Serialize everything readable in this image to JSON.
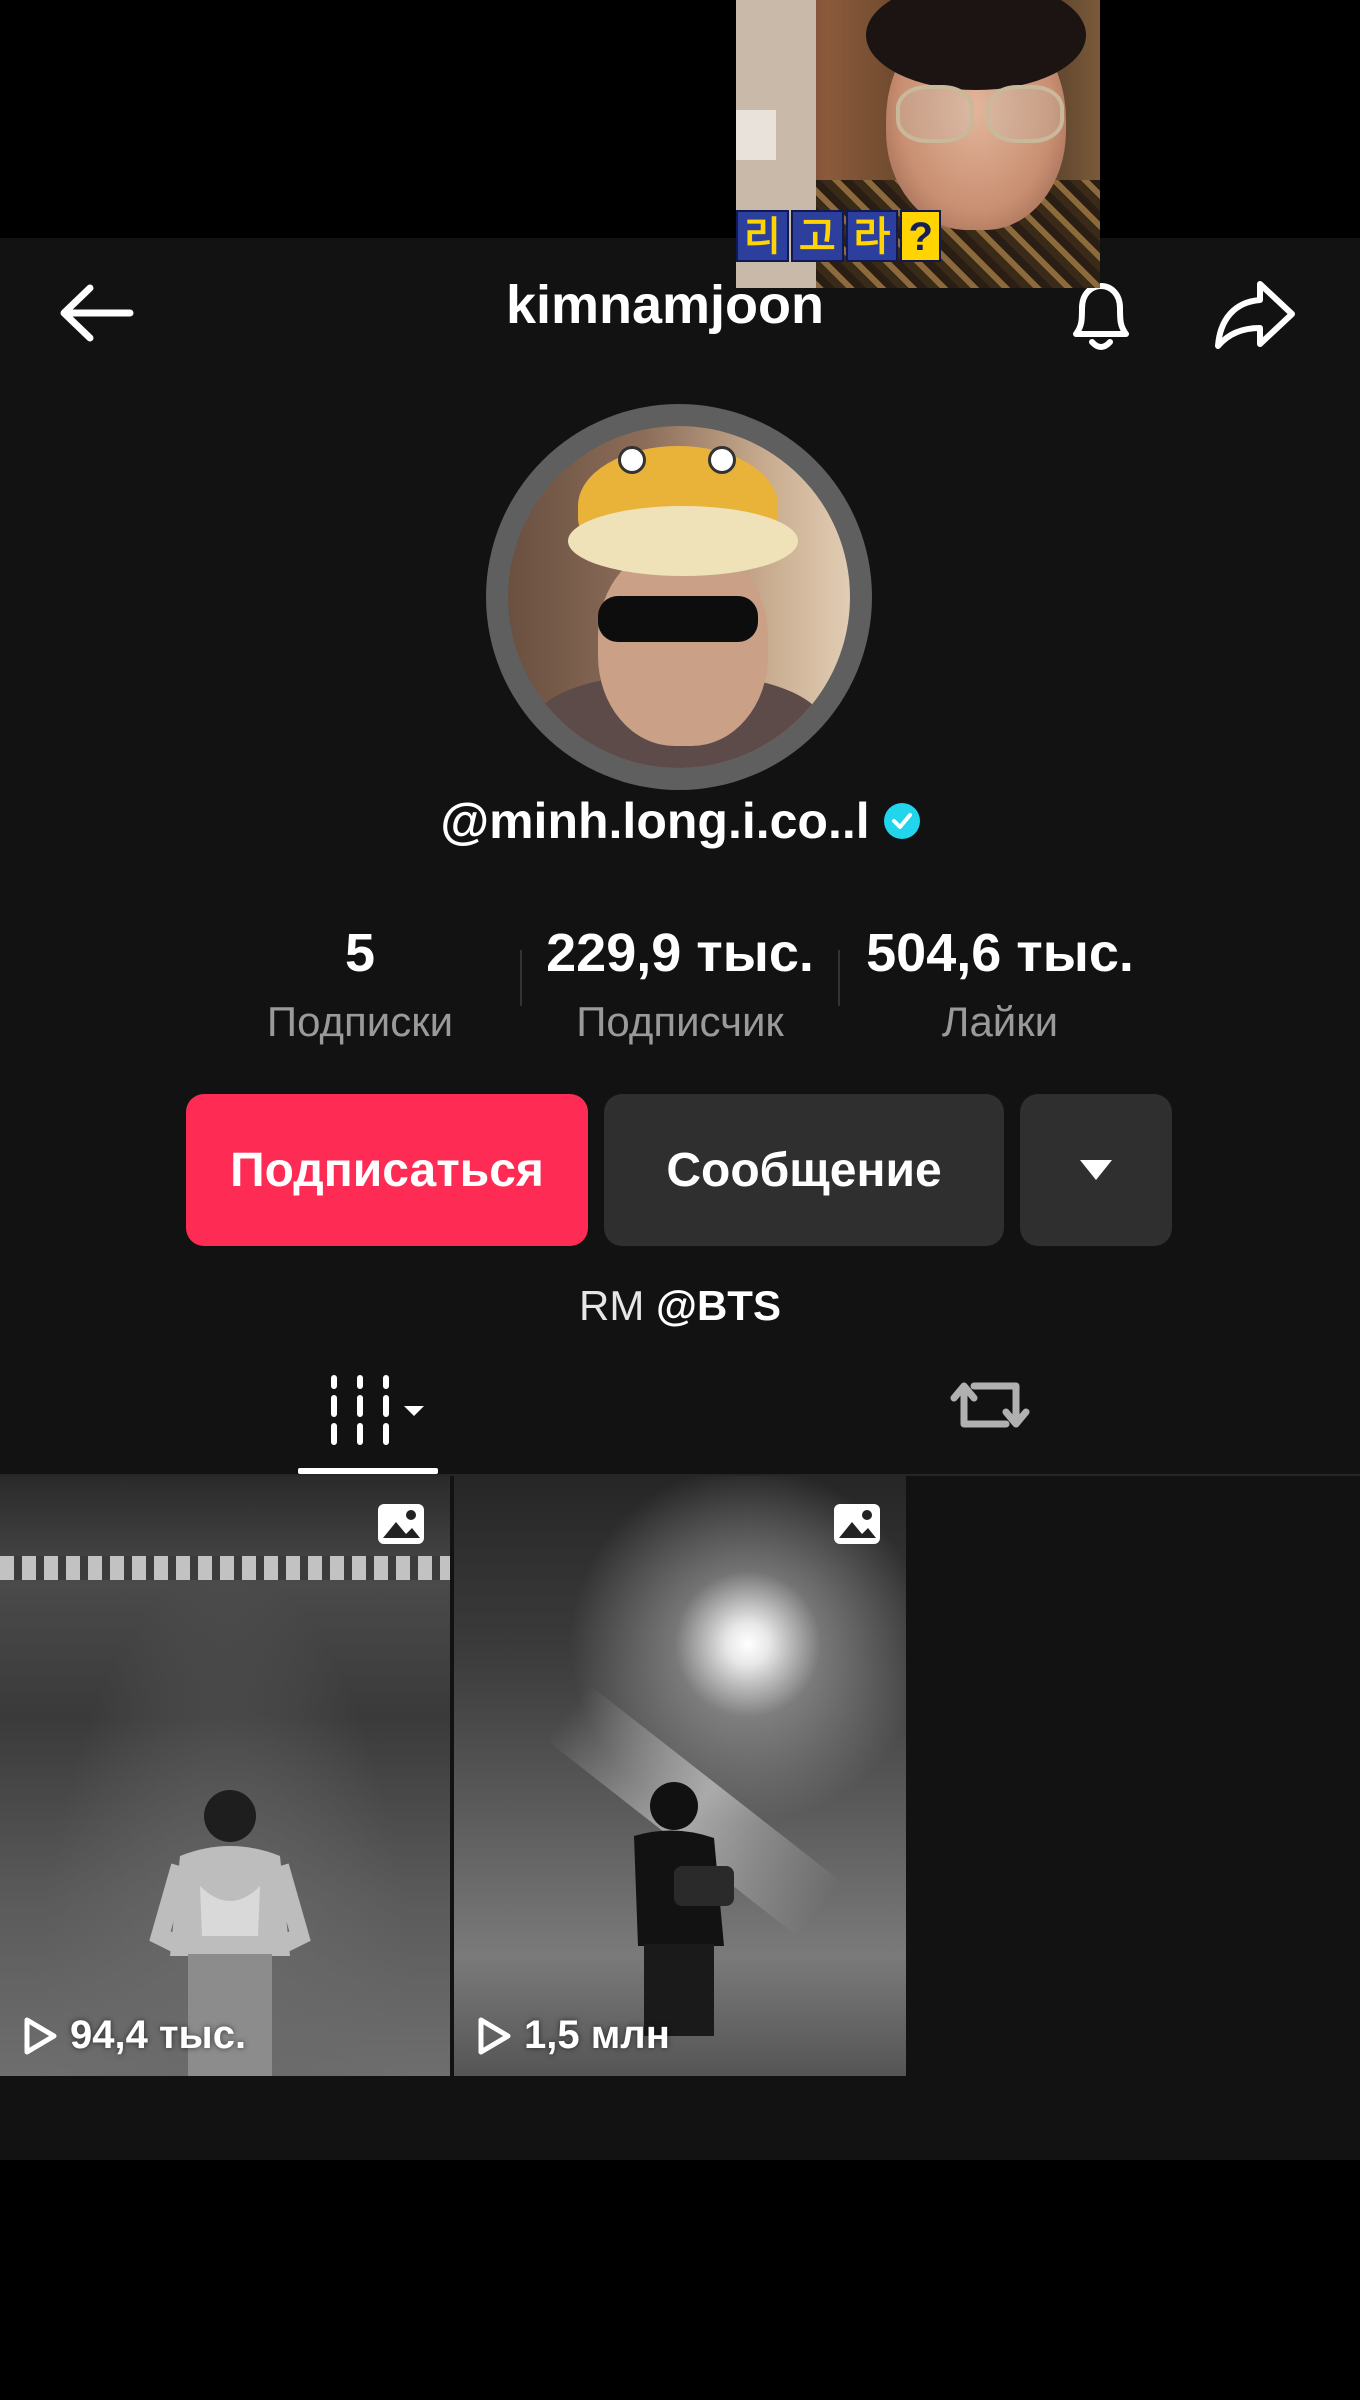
{
  "pip": {
    "caption_chars": [
      "리",
      "고",
      "라"
    ],
    "caption_q": "?"
  },
  "header": {
    "title": "kimnamjoon"
  },
  "profile": {
    "username": "@minh.long.i.co..l",
    "verified": true,
    "stats": [
      {
        "value": "5",
        "label": "Подписки"
      },
      {
        "value": "229,9 тыс.",
        "label": "Подписчик"
      },
      {
        "value": "504,6 тыс.",
        "label": "Лайки"
      }
    ],
    "buttons": {
      "follow": "Подписаться",
      "message": "Сообщение"
    },
    "bio_prefix": "RM ",
    "bio_mention": "@BTS"
  },
  "videos": [
    {
      "views": "94,4 тыс.",
      "type_icon": "photo-icon"
    },
    {
      "views": "1,5 млн",
      "type_icon": "photo-icon"
    }
  ],
  "colors": {
    "background": "#121212",
    "follow_button": "#fe2c55",
    "secondary_button": "#2f2f2f",
    "verified_badge": "#20d5ec"
  }
}
